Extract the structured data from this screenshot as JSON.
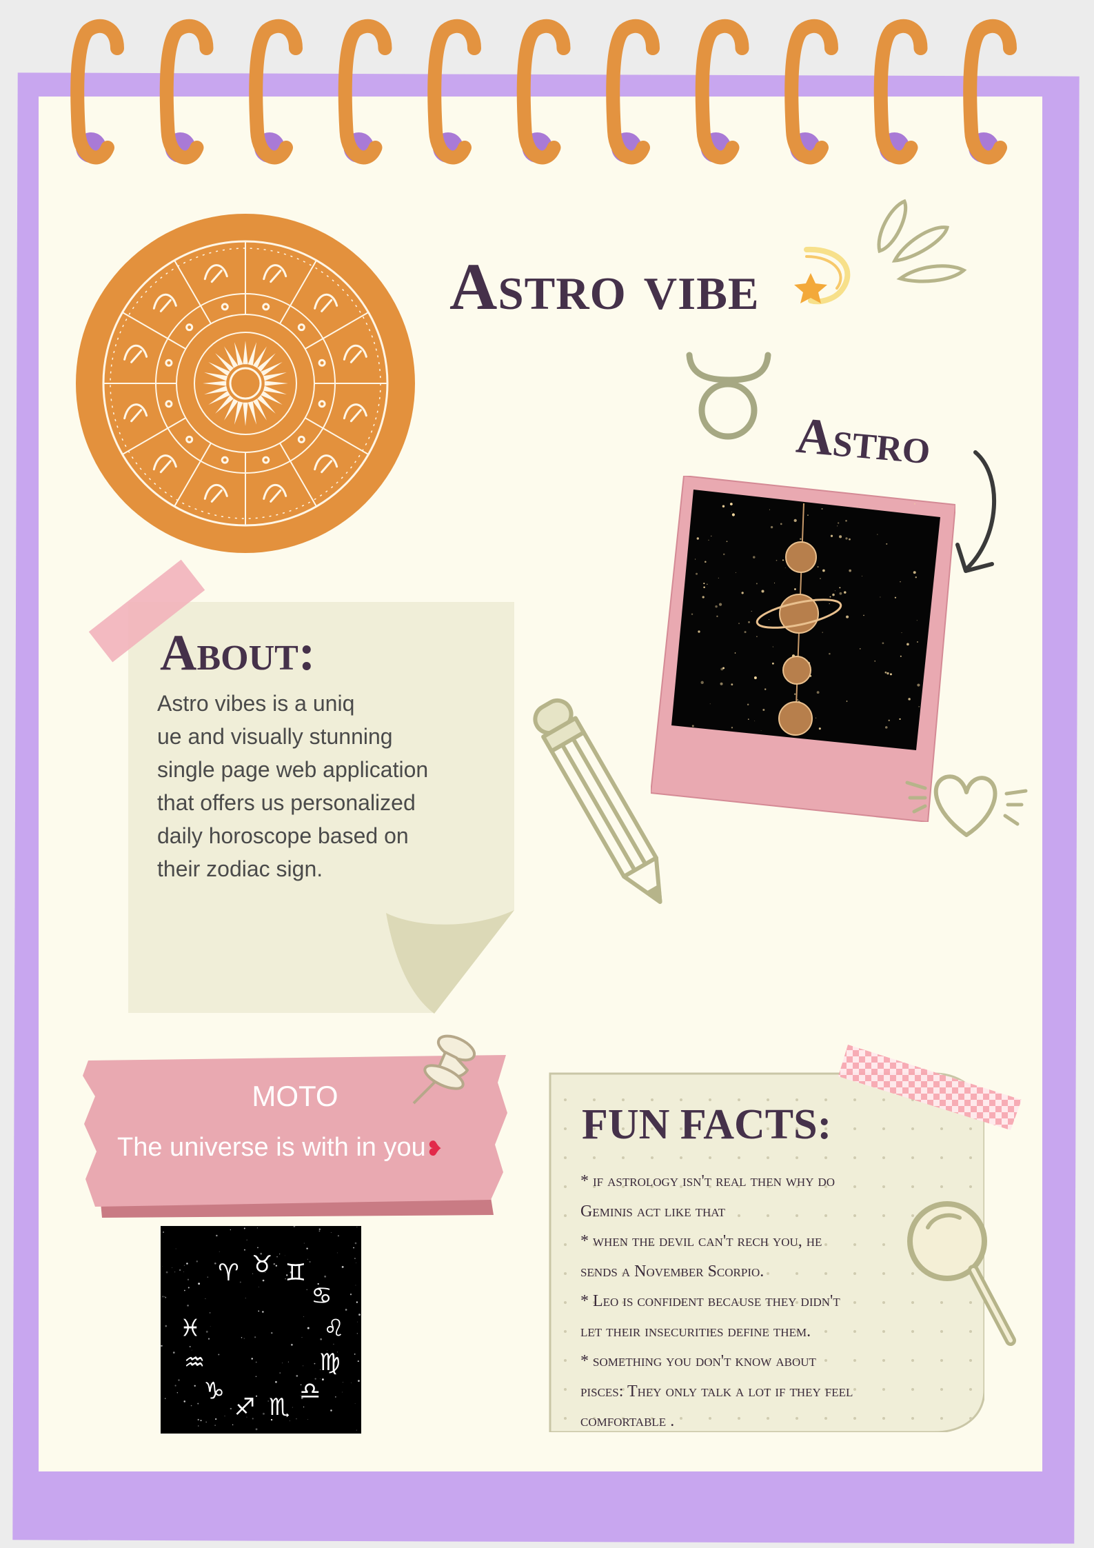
{
  "title": "Astro vibe",
  "side_label": "Astro",
  "about": {
    "heading": "About:",
    "lines": [
      "Astro vibes is a uniq",
      "ue and visually stunning",
      "single page web application",
      "that offers us personalized",
      "daily horoscope based on",
      "their zodiac sign."
    ]
  },
  "moto": {
    "title": "MOTO",
    "text": "The universe is with in you"
  },
  "fun_facts": {
    "heading": "FUN FACTS:",
    "lines": [
      "* if astrology isn't real then why do",
      "Geminis act like that",
      "*  when the devil can't rech you, he",
      "sends a November Scorpio.",
      "* Leo is confident because they didn't",
      "let their insecurities define them.",
      "* something you don't know about",
      "pisces: They only talk a lot if they feel",
      "comfortable ."
    ]
  },
  "colors": {
    "frame": "#c8a6ef",
    "paper": "#fdfbed",
    "ring": "#e39340",
    "ring_hole": "#a97ad6",
    "heading": "#45314a",
    "zodiac_disc": "#e3913d",
    "sage": "#b6b48a",
    "pink": "#e9a9b1"
  },
  "icons": [
    "star-icon",
    "taurus-icon",
    "curved-arrow-icon",
    "heart-icon",
    "pencil-icon",
    "push-pin-icon",
    "magnifier-icon",
    "sparkle-icon",
    "zodiac-wheel-icon"
  ]
}
